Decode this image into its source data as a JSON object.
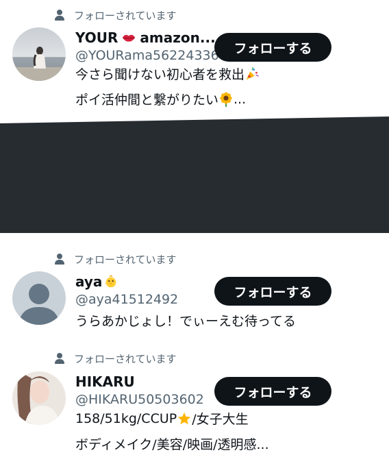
{
  "follows_you_label": "フォローされています",
  "follow_button_label": "フォローする",
  "colors": {
    "text_primary": "#0f1419",
    "text_secondary": "#536471",
    "button_bg": "#0f1419",
    "band": "#272c31"
  },
  "users": [
    {
      "name": "YOUR",
      "name_suffix": "amazon...",
      "name_emoji": "lips-emoji",
      "handle": "@YOURama56224336",
      "bio_line1": "今さら聞けない初心者を救出",
      "bio_line1_emoji": "party-popper-emoji",
      "bio_line2": "ポイ活仲間と繋がりたい",
      "bio_line2_emoji": "sunflower-emoji",
      "bio_line2_suffix": "..."
    },
    {
      "name": "aya",
      "name_emoji": "chick-emoji",
      "handle": "@aya41512492",
      "bio_line1": "うらあかじょし！でぃーえむ待ってる"
    },
    {
      "name": "HIKARU",
      "handle": "@HIKARU50503602",
      "bio_line1": "158/51kg/CCUP",
      "bio_line1_emoji": "star-emoji",
      "bio_line1_suffix": "/女子大生",
      "bio_line2": "ボディメイク/美容/映画/透明感..."
    }
  ]
}
